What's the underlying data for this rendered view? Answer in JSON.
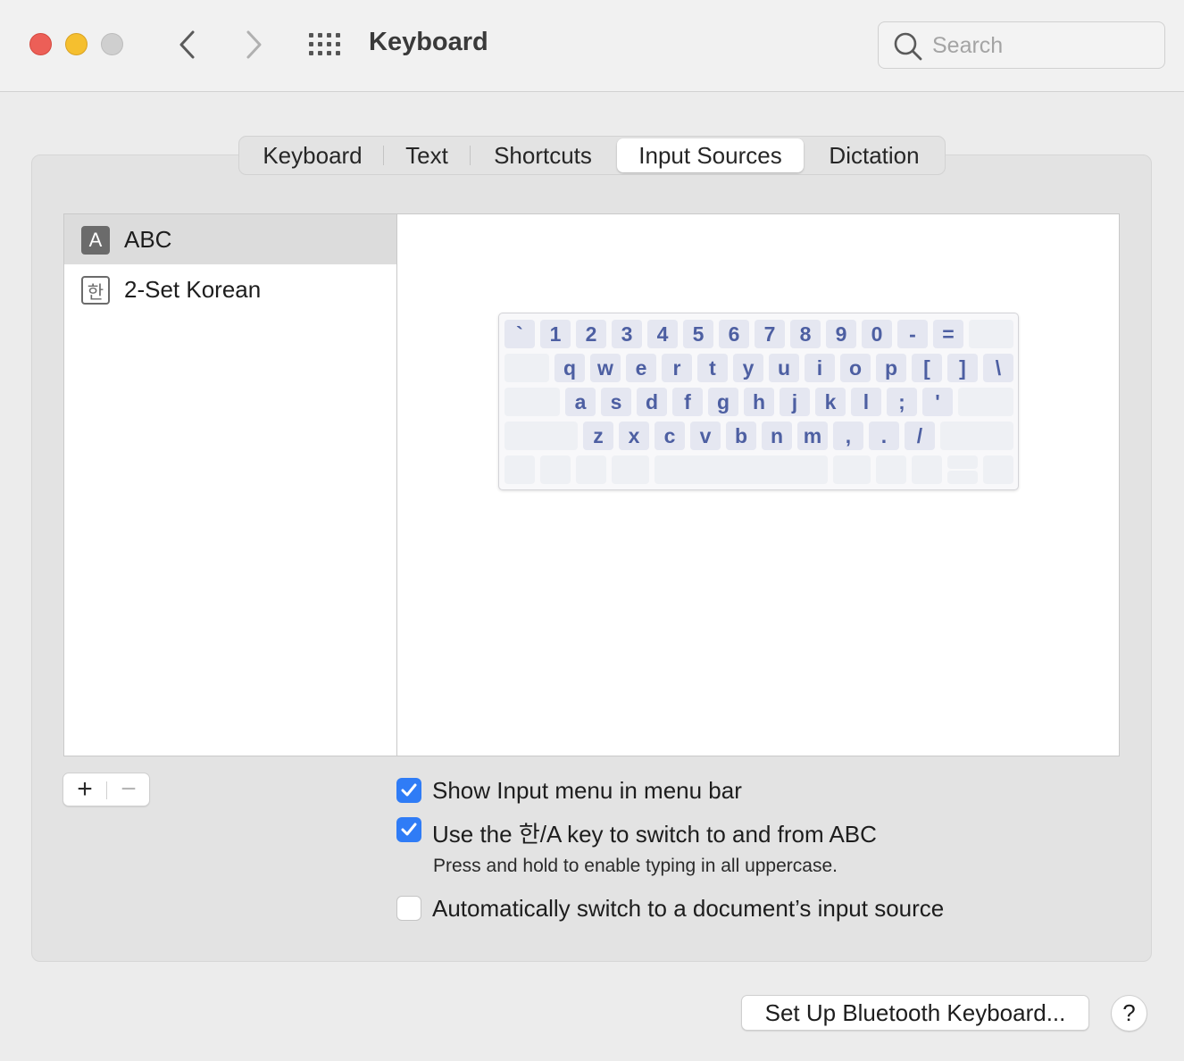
{
  "window": {
    "title": "Keyboard",
    "search_placeholder": "Search"
  },
  "tabs": [
    {
      "label": "Keyboard"
    },
    {
      "label": "Text"
    },
    {
      "label": "Shortcuts"
    },
    {
      "label": "Input Sources",
      "active": true
    },
    {
      "label": "Dictation"
    }
  ],
  "sources": [
    {
      "icon_text": "A",
      "label": "ABC",
      "selected": true
    },
    {
      "icon_text": "한",
      "label": "2-Set Korean",
      "selected": false
    }
  ],
  "keyboard_rows": [
    [
      "`",
      "1",
      "2",
      "3",
      "4",
      "5",
      "6",
      "7",
      "8",
      "9",
      "0",
      "-",
      "="
    ],
    [
      "q",
      "w",
      "e",
      "r",
      "t",
      "y",
      "u",
      "i",
      "o",
      "p",
      "[",
      "]",
      "\\"
    ],
    [
      "a",
      "s",
      "d",
      "f",
      "g",
      "h",
      "j",
      "k",
      "l",
      ";",
      "'"
    ],
    [
      "z",
      "x",
      "c",
      "v",
      "b",
      "n",
      "m",
      ",",
      ".",
      "/"
    ]
  ],
  "controls": {
    "add_label": "+",
    "remove_label": "−"
  },
  "options": {
    "show_input_menu": {
      "label": "Show Input menu in menu bar",
      "checked": true
    },
    "use_han_key": {
      "label": "Use the 한/A key to switch to and from ABC",
      "checked": true
    },
    "han_key_hint": "Press and hold to enable typing in all uppercase.",
    "auto_switch": {
      "label": "Automatically switch to a document’s input source",
      "checked": false
    }
  },
  "buttons": {
    "bluetooth": "Set Up Bluetooth Keyboard...",
    "help": "?"
  },
  "colors": {
    "accent": "#2f7cf6",
    "key_text": "#4d5fa2"
  }
}
